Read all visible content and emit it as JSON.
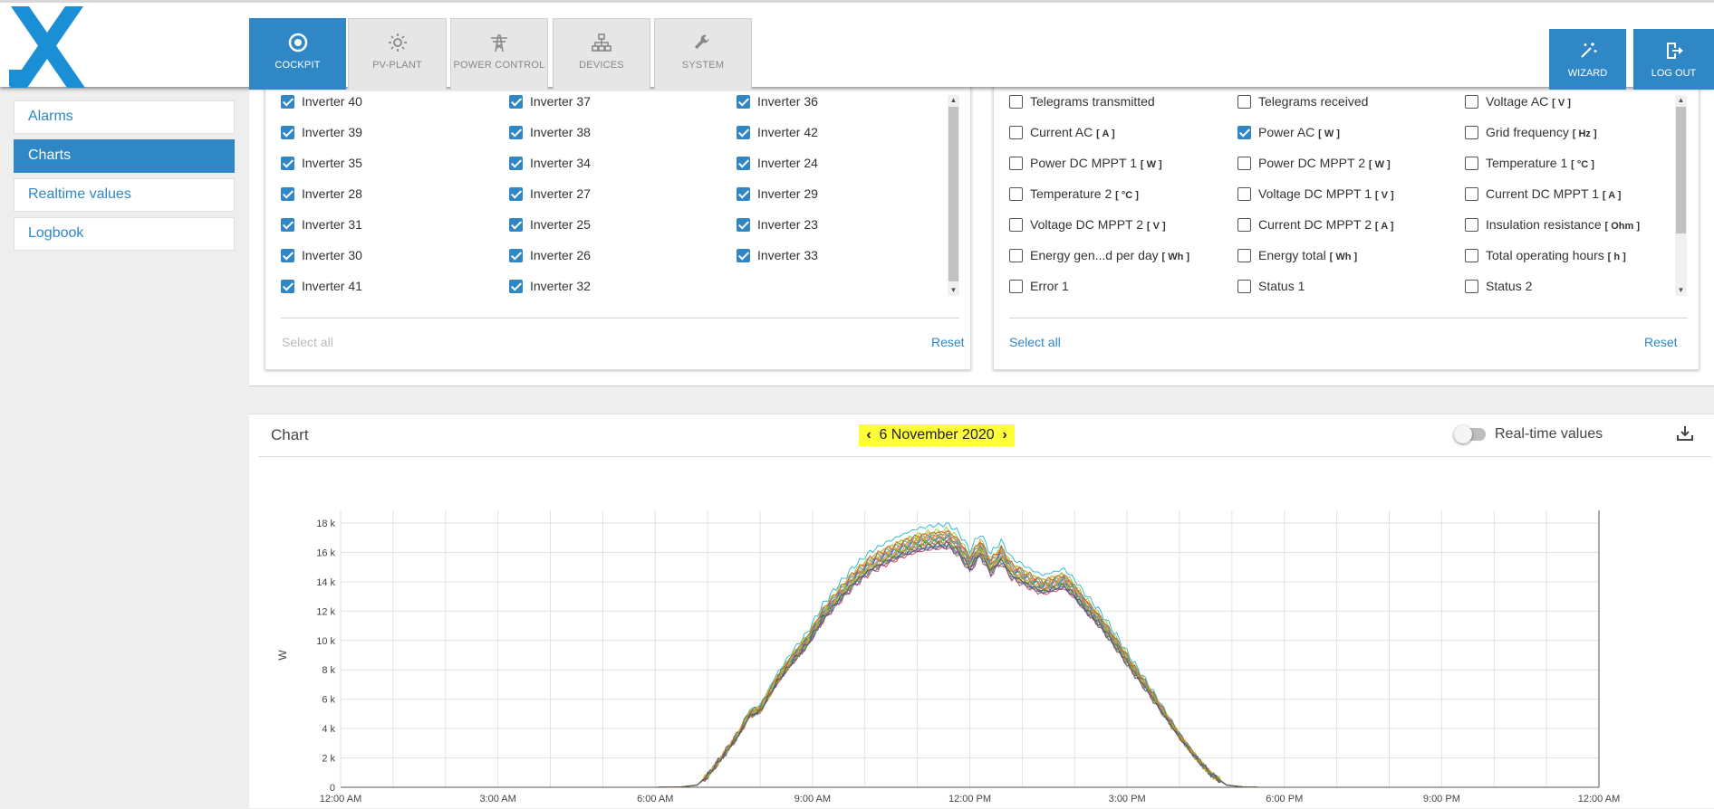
{
  "nav": {
    "tabs": [
      {
        "label": "COCKPIT",
        "icon": "cockpit-icon",
        "active": true
      },
      {
        "label": "PV-PLANT",
        "icon": "sun-icon",
        "active": false
      },
      {
        "label": "POWER CONTROL",
        "icon": "power-tower-icon",
        "active": false
      },
      {
        "label": "DEVICES",
        "icon": "network-icon",
        "active": false
      },
      {
        "label": "SYSTEM",
        "icon": "wrench-icon",
        "active": false
      }
    ],
    "right_buttons": [
      {
        "label": "WIZARD",
        "icon": "magic-wand-icon"
      },
      {
        "label": "LOG OUT",
        "icon": "logout-icon"
      }
    ],
    "accent": "#2f87c6"
  },
  "sidebar": {
    "items": [
      {
        "label": "Alarms",
        "active": false
      },
      {
        "label": "Charts",
        "active": true
      },
      {
        "label": "Realtime values",
        "active": false
      },
      {
        "label": "Logbook",
        "active": false
      }
    ]
  },
  "inverters": {
    "items": [
      {
        "label": "Inverter 40",
        "checked": true
      },
      {
        "label": "Inverter 37",
        "checked": true
      },
      {
        "label": "Inverter 36",
        "checked": true
      },
      {
        "label": "Inverter 39",
        "checked": true
      },
      {
        "label": "Inverter 38",
        "checked": true
      },
      {
        "label": "Inverter 42",
        "checked": true
      },
      {
        "label": "Inverter 35",
        "checked": true
      },
      {
        "label": "Inverter 34",
        "checked": true
      },
      {
        "label": "Inverter 24",
        "checked": true
      },
      {
        "label": "Inverter 28",
        "checked": true
      },
      {
        "label": "Inverter 27",
        "checked": true
      },
      {
        "label": "Inverter 29",
        "checked": true
      },
      {
        "label": "Inverter 31",
        "checked": true
      },
      {
        "label": "Inverter 25",
        "checked": true
      },
      {
        "label": "Inverter 23",
        "checked": true
      },
      {
        "label": "Inverter 30",
        "checked": true
      },
      {
        "label": "Inverter 26",
        "checked": true
      },
      {
        "label": "Inverter 33",
        "checked": true
      },
      {
        "label": "Inverter 41",
        "checked": true
      },
      {
        "label": "Inverter 32",
        "checked": true
      }
    ],
    "select_all": "Select all",
    "reset": "Reset"
  },
  "parameters": {
    "items": [
      {
        "label": "Telegrams transmitted",
        "unit": "",
        "checked": false
      },
      {
        "label": "Telegrams received",
        "unit": "",
        "checked": false
      },
      {
        "label": "Voltage AC",
        "unit": "[ V ]",
        "checked": false
      },
      {
        "label": "Current AC",
        "unit": "[ A ]",
        "checked": false
      },
      {
        "label": "Power AC",
        "unit": "[ W ]",
        "checked": true
      },
      {
        "label": "Grid frequency",
        "unit": "[ Hz ]",
        "checked": false
      },
      {
        "label": "Power DC MPPT 1",
        "unit": "[ W ]",
        "checked": false
      },
      {
        "label": "Power DC MPPT 2",
        "unit": "[ W ]",
        "checked": false
      },
      {
        "label": "Temperature 1",
        "unit": "[ °C ]",
        "checked": false
      },
      {
        "label": "Temperature 2",
        "unit": "[ °C ]",
        "checked": false
      },
      {
        "label": "Voltage DC MPPT 1",
        "unit": "[ V ]",
        "checked": false
      },
      {
        "label": "Current DC MPPT 1",
        "unit": "[ A ]",
        "checked": false
      },
      {
        "label": "Voltage DC MPPT 2",
        "unit": "[ V ]",
        "checked": false
      },
      {
        "label": "Current DC MPPT 2",
        "unit": "[ A ]",
        "checked": false
      },
      {
        "label": "Insulation resistance",
        "unit": "[ Ohm ]",
        "checked": false
      },
      {
        "label": "Energy gen...d per day",
        "unit": "[ Wh ]",
        "checked": false
      },
      {
        "label": "Energy total",
        "unit": "[ Wh ]",
        "checked": false
      },
      {
        "label": "Total operating hours",
        "unit": "[ h ]",
        "checked": false
      },
      {
        "label": "Error 1",
        "unit": "",
        "checked": false
      },
      {
        "label": "Status 1",
        "unit": "",
        "checked": false
      },
      {
        "label": "Status 2",
        "unit": "",
        "checked": false
      }
    ],
    "select_all": "Select all",
    "reset": "Reset"
  },
  "chart_panel": {
    "title": "Chart",
    "date": "6 November 2020",
    "date_highlight": "#ffff38",
    "realtime_label": "Real-time values",
    "realtime_on": false,
    "download_icon": "download-icon"
  },
  "chart_data": {
    "type": "line",
    "ylabel": "W",
    "xlabel": "",
    "ylim": [
      0,
      18000
    ],
    "y_ticks": [
      0,
      2000,
      4000,
      6000,
      8000,
      10000,
      12000,
      14000,
      16000,
      18000
    ],
    "y_tick_labels": [
      "0",
      "2 k",
      "4 k",
      "6 k",
      "8 k",
      "10 k",
      "12 k",
      "14 k",
      "16 k",
      "18 k"
    ],
    "xlim": [
      0,
      24
    ],
    "x_ticks": [
      0,
      3,
      6,
      9,
      12,
      15,
      18,
      21,
      24
    ],
    "x_tick_labels": [
      "12:00 AM",
      "3:00 AM",
      "6:00 AM",
      "9:00 AM",
      "12:00 PM",
      "3:00 PM",
      "6:00 PM",
      "9:00 PM",
      "12:00 AM"
    ],
    "grid": true,
    "series_count": 20,
    "series_colors": [
      "#1fb5c9",
      "#b9c92b",
      "#d43b3b",
      "#8a5fb0",
      "#3e6fc0",
      "#e09a2d",
      "#53a653",
      "#c2569a",
      "#7f7f7f",
      "#2a9d8f",
      "#e36c5c",
      "#5b8dd9",
      "#9bc53d",
      "#d7a31a",
      "#6a4c93",
      "#1982c4",
      "#ff924c",
      "#8ac926",
      "#c05621",
      "#4a5568"
    ],
    "profile_x": [
      6.0,
      6.5,
      6.8,
      7.0,
      7.3,
      7.6,
      7.8,
      8.0,
      8.3,
      8.6,
      8.9,
      9.2,
      9.5,
      9.8,
      10.1,
      10.4,
      10.7,
      11.0,
      11.3,
      11.6,
      11.8,
      12.0,
      12.2,
      12.4,
      12.6,
      12.8,
      13.0,
      13.2,
      13.4,
      13.6,
      13.8,
      14.0,
      14.2,
      14.5,
      14.8,
      15.1,
      15.4,
      15.7,
      16.0,
      16.3,
      16.6,
      16.9,
      17.2,
      17.5,
      24.0
    ],
    "profile_y": [
      0,
      30,
      150,
      800,
      2200,
      3700,
      5000,
      5300,
      7200,
      8700,
      10000,
      11800,
      13100,
      14300,
      15200,
      15800,
      16300,
      16700,
      16900,
      17000,
      16400,
      15300,
      16400,
      15100,
      15900,
      14800,
      14400,
      14000,
      13700,
      13900,
      14100,
      13400,
      12500,
      11300,
      9800,
      8200,
      6700,
      5100,
      3500,
      2100,
      900,
      150,
      30,
      0,
      0
    ],
    "series_scales": [
      1.055,
      1.02,
      0.96,
      0.975,
      1.0,
      1.01,
      0.99,
      0.985,
      1.005,
      0.97,
      0.995,
      1.015,
      1.03,
      0.98,
      0.965,
      1.0,
      1.008,
      0.99,
      1.025,
      0.975
    ]
  }
}
